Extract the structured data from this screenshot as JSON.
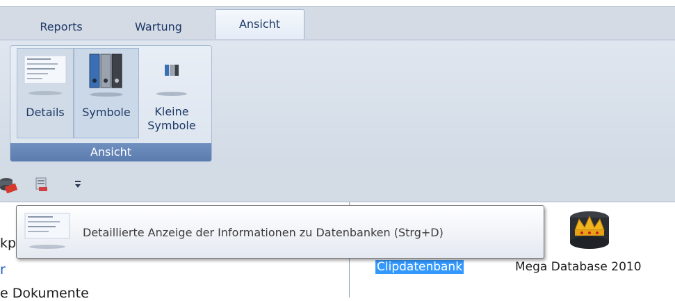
{
  "tabs": {
    "reports": "Reports",
    "wartung": "Wartung",
    "ansicht": "Ansicht"
  },
  "ribbon": {
    "group_label": "Ansicht",
    "buttons": {
      "details": "Details",
      "symbole": "Symbole",
      "kleine_line1": "Kleine",
      "kleine_line2": "Symbole"
    }
  },
  "left_pane": {
    "line1": "kp",
    "line2": "r",
    "line3": "e Dokumente"
  },
  "databases": {
    "clip": "Clipdatenbank",
    "mega": "Mega Database 2010"
  },
  "tooltip": {
    "text": "Detaillierte Anzeige der Informationen zu Datenbanken (Strg+D)"
  },
  "colors": {
    "selection": "#3399ff",
    "group_footer": "#5b7cae",
    "tab_text": "#1e3966"
  },
  "icons": [
    "details-view-icon",
    "large-icons-view-icon",
    "small-icons-view-icon",
    "database-red-icon",
    "database-delete-icon",
    "customize-toolbar-icon",
    "mega-database-crown-icon"
  ]
}
